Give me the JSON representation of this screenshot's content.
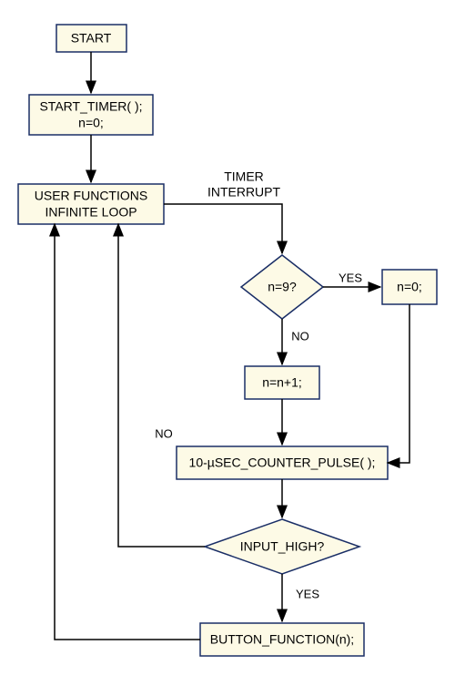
{
  "flow": {
    "start": "START",
    "start_timer_l1": "START_TIMER( );",
    "start_timer_l2": "n=0;",
    "user_fn_l1": "USER FUNCTIONS",
    "user_fn_l2": "INFINITE LOOP",
    "timer_int_l1": "TIMER",
    "timer_int_l2": "INTERRUPT",
    "decision_n9": "n=9?",
    "yes1": "YES",
    "no1": "NO",
    "reset_n": "n=0;",
    "inc_n": "n=n+1;",
    "counter_pulse": "10-µSEC_COUNTER_PULSE( );",
    "input_high": "INPUT_HIGH?",
    "yes2": "YES",
    "no2": "NO",
    "button_fn": "BUTTON_FUNCTION(n);"
  }
}
